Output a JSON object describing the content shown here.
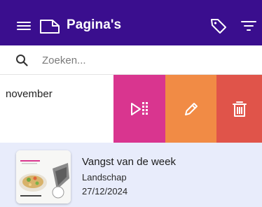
{
  "appbar": {
    "title": "Pagina's",
    "background": "#3a0e8e"
  },
  "search": {
    "placeholder": "Zoeken..."
  },
  "list": {
    "items": [
      {
        "title_partial": "november",
        "actions": [
          {
            "icon": "play-list-icon",
            "color": "#d9358f"
          },
          {
            "icon": "pencil-icon",
            "color": "#f18b45"
          },
          {
            "icon": "trash-icon",
            "color": "#e0544a"
          }
        ]
      },
      {
        "title": "Vangst van de week",
        "orientation": "Landschap",
        "date": "27/12/2024",
        "selected_background": "#e8ecfb"
      }
    ]
  }
}
